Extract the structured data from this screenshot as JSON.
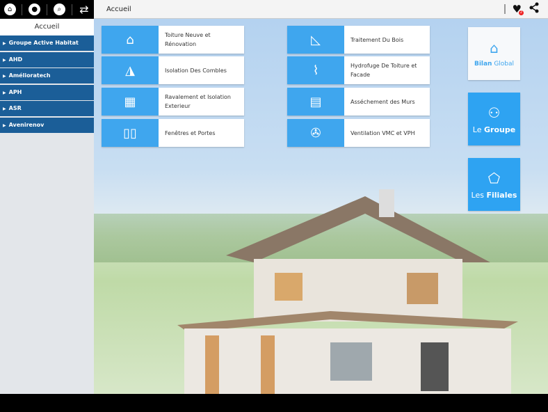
{
  "toolbar": {
    "icons": [
      "home-icon",
      "user-icon",
      "search-icon",
      "sync-icon"
    ]
  },
  "header": {
    "title": "Accueil",
    "notification_count": "2"
  },
  "sidebar": {
    "title": "Accueil",
    "items": [
      {
        "label": "Groupe Active Habitat"
      },
      {
        "label": "AHD"
      },
      {
        "label": "Amélioratech"
      },
      {
        "label": "APH"
      },
      {
        "label": "ASR"
      },
      {
        "label": "Avenirenov"
      }
    ]
  },
  "tiles": [
    {
      "label": "Toiture Neuve et Rénovation",
      "icon": "roof-icon"
    },
    {
      "label": "Isolation Des Combles",
      "icon": "attic-icon"
    },
    {
      "label": "Ravalement et Isolation Exterieur",
      "icon": "brick-wall-icon"
    },
    {
      "label": "Fenêtres et Portes",
      "icon": "window-icon"
    },
    {
      "label": "Traitement Du Bois",
      "icon": "wood-frame-icon"
    },
    {
      "label": "Hydrofuge De Toiture et Facade",
      "icon": "spray-icon"
    },
    {
      "label": "Asséchement des Murs",
      "icon": "wall-drying-icon"
    },
    {
      "label": "Ventilation VMC et VPH",
      "icon": "fan-icon"
    }
  ],
  "big_tiles": {
    "bilan": {
      "bold": "Bilan",
      "rest": " Global"
    },
    "groupe": {
      "pre": "Le ",
      "bold": "Groupe"
    },
    "filiales": {
      "pre": "Les ",
      "bold": "Filiales"
    }
  },
  "colors": {
    "accent": "#3fa6ee",
    "sidebar": "#1b5e98"
  }
}
